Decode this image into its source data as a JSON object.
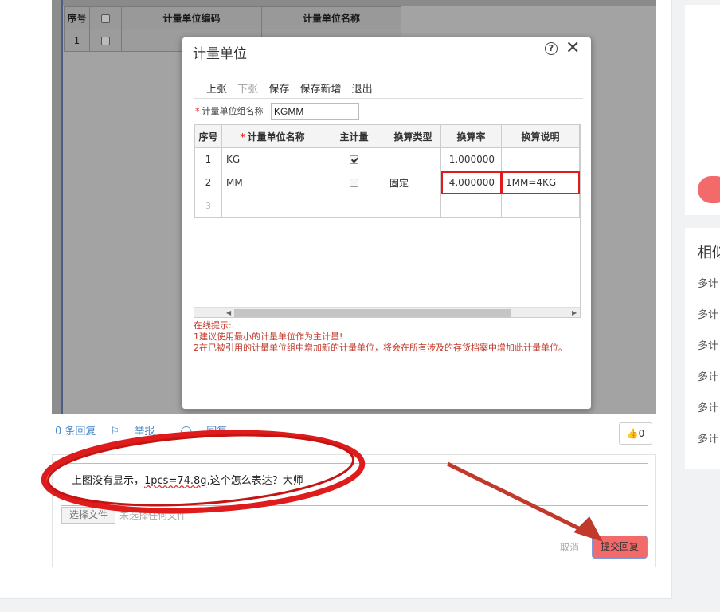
{
  "background_table": {
    "headers": [
      "序号",
      "",
      "计量单位编码",
      "计量单位名称"
    ],
    "row": {
      "no": "1"
    }
  },
  "dialog": {
    "title": "计量单位",
    "toolbar": [
      "上张",
      "下张",
      "保存",
      "保存新增",
      "退出"
    ],
    "group_label": "计量单位组名称",
    "group_value": "KGMM",
    "grid_headers": [
      "序号",
      "计量单位名称",
      "主计量",
      "换算类型",
      "换算率",
      "换算说明"
    ],
    "rows": [
      {
        "no": "1",
        "name": "KG",
        "main": true,
        "type": "",
        "rate": "1.000000",
        "note": ""
      },
      {
        "no": "2",
        "name": "MM",
        "main": false,
        "type": "固定",
        "rate": "4.000000",
        "note": "1MM=4KG"
      },
      {
        "no": "3",
        "name": "",
        "main": null,
        "type": "",
        "rate": "",
        "note": ""
      }
    ],
    "hint_lines": [
      "在线提示:",
      "1建议使用最小的计量单位作为主计量!",
      "2在已被引用的计量单位组中增加新的计量单位，将会在所有涉及的存货档案中增加此计量单位。"
    ]
  },
  "actions": {
    "replies": "0 条回复",
    "report": "举报",
    "reply": "回复",
    "like_count": "0"
  },
  "reply_box": {
    "text_before": "上图没有显示，",
    "text_wavy": "1pcs=74.8g",
    "text_after": ",这个怎么表达？大师",
    "file_button": "选择文件",
    "file_status": "未选择任何文件",
    "cancel": "取消",
    "submit": "提交回复"
  },
  "sidebar": {
    "title": "相似",
    "items": [
      "多计",
      "多计",
      "多计",
      "多计",
      "多计",
      "多计"
    ]
  },
  "colors": {
    "accent_red": "#f26a6a",
    "link_blue": "#4a86c7",
    "annotation_red": "#e01b1b"
  }
}
